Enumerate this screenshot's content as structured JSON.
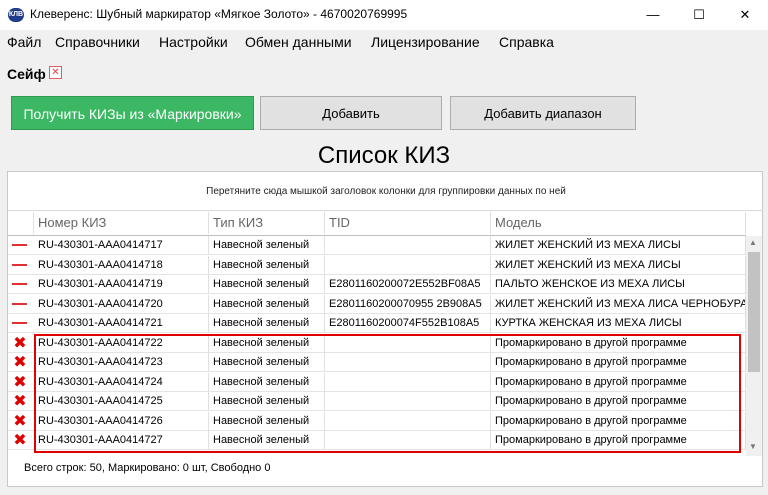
{
  "window": {
    "title": "Клеверенс: Шубный маркиратор «Мягкое Золото» - 4670020769995",
    "minimize": "—",
    "maximize": "☐",
    "close": "✕",
    "app_icon": "КЛВ"
  },
  "menu": [
    "Файл",
    "Справочники",
    "Настройки",
    "Обмен данными",
    "Лицензирование",
    "Справка"
  ],
  "safe": {
    "label": "Сейф",
    "close_glyph": "✕"
  },
  "buttons": {
    "get_kiz": "Получить КИЗы из «Маркировки»",
    "add": "Добавить",
    "add_range": "Добавить диапазон"
  },
  "list_title": "Список КИЗ",
  "grid": {
    "group_hint": "Перетяните сюда мышкой заголовок колонки для группировки данных по ней",
    "columns": [
      "Номер КИЗ",
      "Тип КИЗ",
      "TID",
      "Модель"
    ],
    "rows": [
      {
        "status": "minus",
        "kiz": "RU-430301-AAA0414717",
        "type": "Навесной зеленый",
        "tid": "",
        "model": "ЖИЛЕТ ЖЕНСКИЙ ИЗ МЕХА ЛИСЫ"
      },
      {
        "status": "minus",
        "kiz": "RU-430301-AAA0414718",
        "type": "Навесной зеленый",
        "tid": "",
        "model": "ЖИЛЕТ ЖЕНСКИЙ ИЗ МЕХА ЛИСЫ"
      },
      {
        "status": "minus",
        "kiz": "RU-430301-AAA0414719",
        "type": "Навесной зеленый",
        "tid": "E2801160200072E552BF08A5",
        "model": "ПАЛЬТО ЖЕНСКОЕ ИЗ МЕХА ЛИСЫ"
      },
      {
        "status": "minus",
        "kiz": "RU-430301-AAA0414720",
        "type": "Навесной зеленый",
        "tid": "E2801160200070955 2B908A5",
        "model": "ЖИЛЕТ ЖЕНСКИЙ ИЗ МЕХА ЛИСА ЧЕРНОБУРАЯ"
      },
      {
        "status": "minus",
        "kiz": "RU-430301-AAA0414721",
        "type": "Навесной зеленый",
        "tid": "E2801160200074F552B108A5",
        "model": "КУРТКА ЖЕНСКАЯ ИЗ МЕХА ЛИСЫ"
      },
      {
        "status": "error",
        "kiz": "RU-430301-AAA0414722",
        "type": "Навесной зеленый",
        "tid": "",
        "model": "Промаркировано в другой программе"
      },
      {
        "status": "error",
        "kiz": "RU-430301-AAA0414723",
        "type": "Навесной зеленый",
        "tid": "",
        "model": "Промаркировано в другой программе"
      },
      {
        "status": "error",
        "kiz": "RU-430301-AAA0414724",
        "type": "Навесной зеленый",
        "tid": "",
        "model": "Промаркировано в другой программе"
      },
      {
        "status": "error",
        "kiz": "RU-430301-AAA0414725",
        "type": "Навесной зеленый",
        "tid": "",
        "model": "Промаркировано в другой программе"
      },
      {
        "status": "error",
        "kiz": "RU-430301-AAA0414726",
        "type": "Навесной зеленый",
        "tid": "",
        "model": "Промаркировано в другой программе"
      },
      {
        "status": "error",
        "kiz": "RU-430301-AAA0414727",
        "type": "Навесной зеленый",
        "tid": "",
        "model": "Промаркировано в другой программе"
      }
    ],
    "footer": "Всего строк: 50, Маркировано: 0 шт, Свободно 0"
  },
  "colors": {
    "accent_green": "#3cb864",
    "error_red": "#e00000"
  },
  "icons": {
    "minus_status": "minus-icon",
    "error_status": "x-icon",
    "scroll_up": "▲",
    "scroll_down": "▼"
  }
}
